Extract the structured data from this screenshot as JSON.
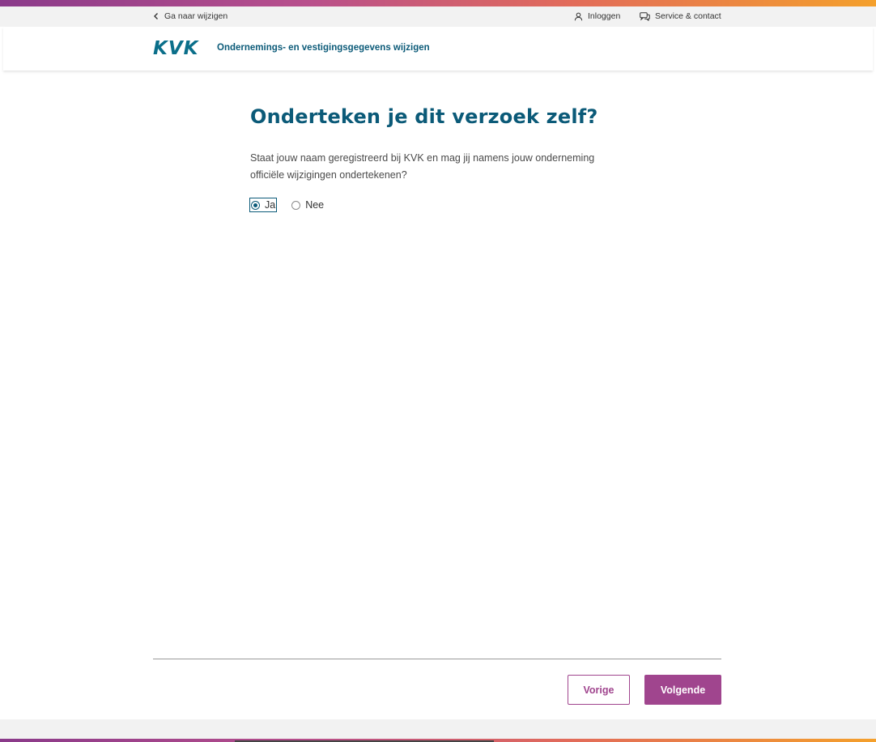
{
  "utility_bar": {
    "back_label": "Ga naar wijzigen",
    "login_label": "Inloggen",
    "service_label": "Service & contact"
  },
  "header": {
    "logo_text": "KVK",
    "app_title": "Ondernemings- en vestigingsgegevens wijzigen"
  },
  "main": {
    "heading": "Onderteken je dit verzoek zelf?",
    "description": "Staat jouw naam geregistreerd bij KVK en mag jij namens jouw onderneming officiële wijzigingen ondertekenen?",
    "options": [
      {
        "label": "Ja",
        "checked": true
      },
      {
        "label": "Nee",
        "checked": false
      }
    ]
  },
  "actions": {
    "previous_label": "Vorige",
    "next_label": "Volgende"
  },
  "colors": {
    "brand_blue": "#0b5a78",
    "accent_purple": "#a0458e"
  },
  "icons": [
    "chevron-left-icon",
    "user-icon",
    "chat-icon"
  ]
}
